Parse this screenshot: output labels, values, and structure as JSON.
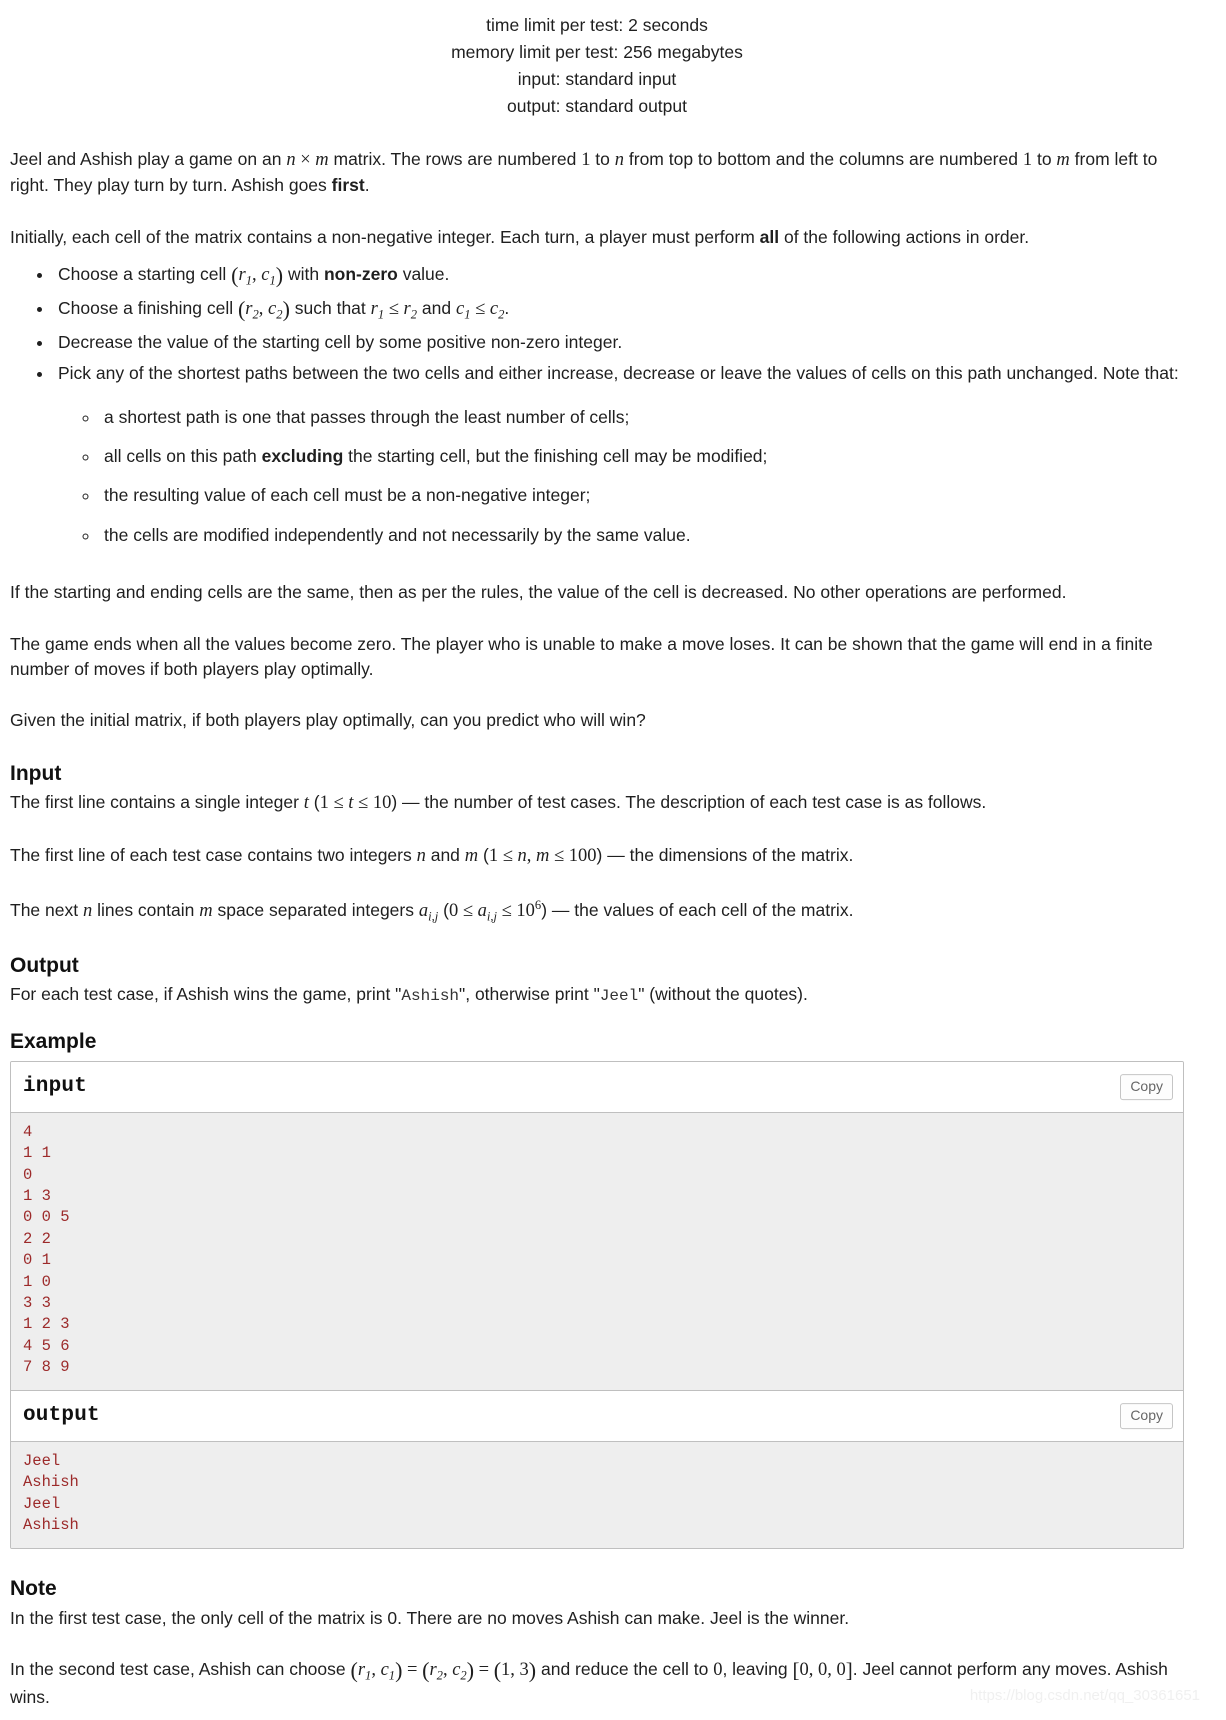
{
  "limits": {
    "time": "time limit per test: 2 seconds",
    "memory": "memory limit per test: 256 megabytes",
    "input": "input: standard input",
    "output": "output: standard output"
  },
  "statement": {
    "p1_a": "Jeel and Ashish play a game on an ",
    "p1_n": "n",
    "p1_times": "×",
    "p1_m": "m",
    "p1_b": " matrix. The rows are numbered ",
    "p1_one": "1",
    "p1_c": " to ",
    "p1_n2": "n",
    "p1_d": " from top to bottom and the columns are numbered ",
    "p1_one2": "1",
    "p1_e": " to ",
    "p1_m2": "m",
    "p1_f": " from left to right. They play turn by turn. Ashish goes ",
    "p1_first": "first",
    "p1_g": ".",
    "p2_a": "Initially, each cell of the matrix contains a non-negative integer. Each turn, a player must perform ",
    "p2_all": "all",
    "p2_b": " of the following actions in order."
  },
  "bullets": {
    "b1_a": "Choose a starting cell ",
    "b1_r1": "r",
    "b1_r1s": "1",
    "b1_comma": ", ",
    "b1_c1": "c",
    "b1_c1s": "1",
    "b1_b": " with ",
    "b1_nonzero": "non-zero",
    "b1_c": " value.",
    "b2_a": "Choose a finishing cell ",
    "b2_r2": "r",
    "b2_r2s": "2",
    "b2_c2": "c",
    "b2_c2s": "2",
    "b2_b": " such that ",
    "b2_le1_l": "r",
    "b2_le1_ls": "1",
    "b2_le": "≤",
    "b2_le1_r": "r",
    "b2_le1_rs": "2",
    "b2_and": " and ",
    "b2_le2_l": "c",
    "b2_le2_ls": "1",
    "b2_le2_r": "c",
    "b2_le2_rs": "2",
    "b2_c": ".",
    "b3": "Decrease the value of the starting cell by some positive non-zero integer.",
    "b4_a": "Pick any of the shortest paths between the two cells and either increase, decrease or leave the values of cells on this path unchanged. Note that:"
  },
  "subbullets": {
    "s1": "a shortest path is one that passes through the least number of cells;",
    "s2_a": "all cells on this path ",
    "s2_excl": "excluding",
    "s2_b": " the starting cell, but the finishing cell may be modified;",
    "s3": "the resulting value of each cell must be a non-negative integer;",
    "s4": "the cells are modified independently and not necessarily by the same value."
  },
  "statement2": {
    "p3": "If the starting and ending cells are the same, then as per the rules, the value of the cell is decreased. No other operations are performed.",
    "p4": "The game ends when all the values become zero. The player who is unable to make a move loses. It can be shown that the game will end in a finite number of moves if both players play optimally.",
    "p5": "Given the initial matrix, if both players play optimally, can you predict who will win?"
  },
  "input_section": {
    "heading": "Input",
    "l1_a": "The first line contains a single integer ",
    "l1_t": "t",
    "l1_paren_open": " (",
    "l1_one": "1",
    "l1_le": "≤",
    "l1_t2": "t",
    "l1_le2": "≤",
    "l1_ten": "10",
    "l1_paren_close": ")",
    "l1_b": " — the number of test cases. The description of each test case is as follows.",
    "l2_a": "The first line of each test case contains two integers ",
    "l2_n": "n",
    "l2_and": " and ",
    "l2_m": "m",
    "l2_paren_open": " (",
    "l2_one": "1",
    "l2_le": "≤",
    "l2_n2": "n",
    "l2_comma": ", ",
    "l2_m2": "m",
    "l2_le2": "≤",
    "l2_hundred": "100",
    "l2_paren_close": ")",
    "l2_b": " — the dimensions of the matrix.",
    "l3_a": "The next ",
    "l3_n": "n",
    "l3_b": " lines contain ",
    "l3_m": "m",
    "l3_c": " space separated integers ",
    "l3_a1": "a",
    "l3_a1s": "i,j",
    "l3_paren_open": " (",
    "l3_zero": "0",
    "l3_le": "≤",
    "l3_a2": "a",
    "l3_a2s": "i,j",
    "l3_le2": "≤",
    "l3_ten": "10",
    "l3_exp": "6",
    "l3_paren_close": ")",
    "l3_d": " — the values of each cell of the matrix."
  },
  "output_section": {
    "heading": "Output",
    "l1_a": "For each test case, if Ashish wins the game, print \"",
    "l1_ashish": "Ashish",
    "l1_b": "\", otherwise print \"",
    "l1_jeel": "Jeel",
    "l1_c": "\" (without the quotes)."
  },
  "example": {
    "heading": "Example",
    "input_label": "input",
    "output_label": "output",
    "copy_label": "Copy",
    "input_data": "4\n1 1\n0\n1 3\n0 0 5\n2 2\n0 1\n1 0\n3 3\n1 2 3\n4 5 6\n7 8 9",
    "output_data": "Jeel\nAshish\nJeel\nAshish"
  },
  "note_section": {
    "heading": "Note",
    "n1": "In the first test case, the only cell of the matrix is 0. There are no moves Ashish can make. Jeel is the winner.",
    "n2_a": "In the second test case, Ashish can choose ",
    "n2_r1": "r",
    "n2_r1s": "1",
    "n2_c1": "c",
    "n2_c1s": "1",
    "n2_eq1": "=",
    "n2_r2": "r",
    "n2_r2s": "2",
    "n2_c2": "c",
    "n2_c2s": "2",
    "n2_eq2": "=",
    "n2_one": "1",
    "n2_three": "3",
    "n2_b": " and reduce the cell to ",
    "n2_zero": "0",
    "n2_c": ", leaving ",
    "n2_arr": "0, 0, 0",
    "n2_d": ". Jeel cannot perform any moves. Ashish wins."
  },
  "watermark": {
    "text": "https://blog.csdn.net/qq_30361651"
  }
}
